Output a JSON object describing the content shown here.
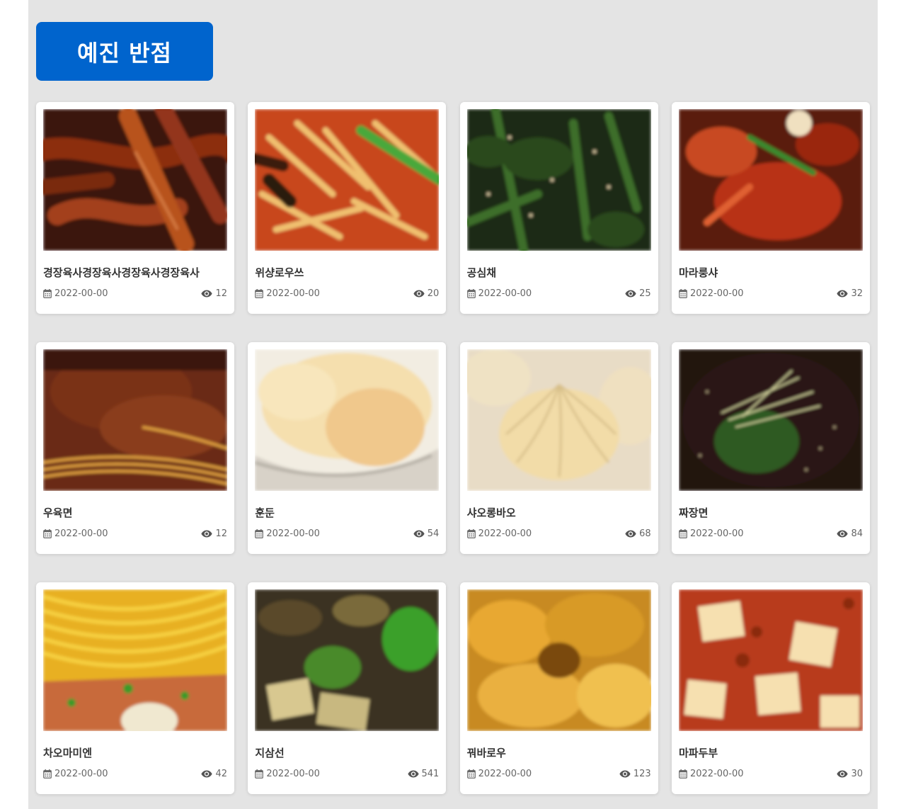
{
  "header": {
    "title": "예진 반점"
  },
  "colors": {
    "page_background": "#e4e4e4",
    "title_button": "#0064cd",
    "card_background": "#ffffff"
  },
  "cards": [
    {
      "title": "경장육사경장육사경장육사경장육사",
      "date": "2022-00-00",
      "views": "12",
      "photo": "food-photo-jingjiang-rousi"
    },
    {
      "title": "위샹로우쓰",
      "date": "2022-00-00",
      "views": "20",
      "photo": "food-photo-yuxiang-rousi"
    },
    {
      "title": "공심채",
      "date": "2022-00-00",
      "views": "25",
      "photo": "food-photo-water-spinach"
    },
    {
      "title": "마라룽샤",
      "date": "2022-00-00",
      "views": "32",
      "photo": "food-photo-mala-crayfish"
    },
    {
      "title": "우육면",
      "date": "2022-00-00",
      "views": "12",
      "photo": "food-photo-beef-noodle"
    },
    {
      "title": "훈둔",
      "date": "2022-00-00",
      "views": "54",
      "photo": "food-photo-wonton"
    },
    {
      "title": "샤오롱바오",
      "date": "2022-00-00",
      "views": "68",
      "photo": "food-photo-xiaolongbao"
    },
    {
      "title": "짜장면",
      "date": "2022-00-00",
      "views": "84",
      "photo": "food-photo-jajangmyeon"
    },
    {
      "title": "차오마미엔",
      "date": "2022-00-00",
      "views": "42",
      "photo": "food-photo-chaomamian"
    },
    {
      "title": "지삼선",
      "date": "2022-00-00",
      "views": "541",
      "photo": "food-photo-disanxian"
    },
    {
      "title": "꿔바로우",
      "date": "2022-00-00",
      "views": "123",
      "photo": "food-photo-guobaorou"
    },
    {
      "title": "마파두부",
      "date": "2022-00-00",
      "views": "30",
      "photo": "food-photo-mapo-tofu"
    }
  ]
}
